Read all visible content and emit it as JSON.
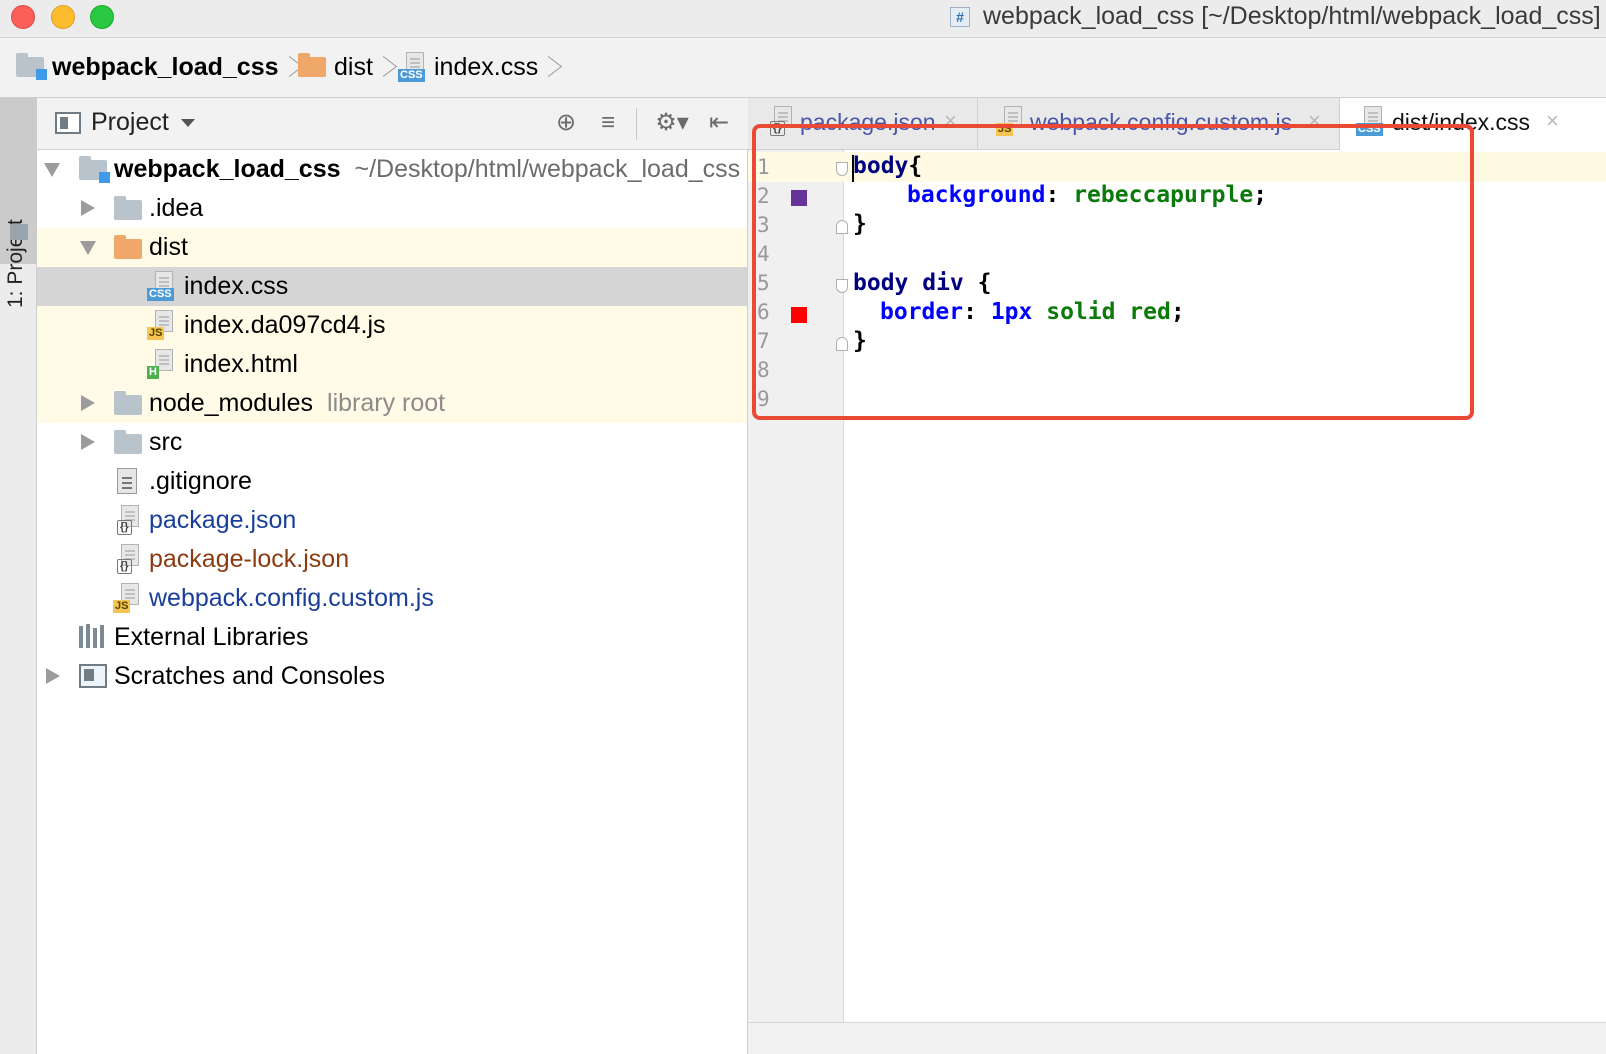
{
  "window": {
    "title": "webpack_load_css [~/Desktop/html/webpack_load_css]"
  },
  "breadcrumb": {
    "items": [
      {
        "label": "webpack_load_css",
        "icon": "module-folder-icon"
      },
      {
        "label": "dist",
        "icon": "folder-icon"
      },
      {
        "label": "index.css",
        "icon": "css-file-icon"
      }
    ]
  },
  "toolstrip": {
    "project_tab": "1: Project"
  },
  "project_panel": {
    "title": "Project",
    "tools": [
      "locate-icon",
      "collapse-all-icon",
      "settings-icon",
      "hide-panel-icon"
    ]
  },
  "tree": {
    "root": {
      "label": "webpack_load_css",
      "path": "~/Desktop/html/webpack_load_css"
    },
    "idea": ".idea",
    "dist": "dist",
    "index_css": "index.css",
    "index_js": "index.da097cd4.js",
    "index_html": "index.html",
    "node_modules": "node_modules",
    "node_modules_hint": "library root",
    "src": "src",
    "gitignore": ".gitignore",
    "package_json": "package.json",
    "package_lock": "package-lock.json",
    "webpack_config": "webpack.config.custom.js",
    "external_libs": "External Libraries",
    "scratches": "Scratches and Consoles"
  },
  "editor": {
    "tabs": [
      {
        "label": "package.json",
        "active": false
      },
      {
        "label": "webpack.config.custom.js",
        "active": false
      },
      {
        "label": "dist/index.css",
        "active": true
      }
    ],
    "line_numbers": [
      "1",
      "2",
      "3",
      "4",
      "5",
      "6",
      "7",
      "8",
      "9"
    ],
    "code": {
      "l1_sel": "body",
      "l1_brace": "{",
      "l2_prop": "background",
      "l2_colon": ":",
      "l2_val": "rebeccapurple",
      "l2_semi": ";",
      "l3": "}",
      "l5_sel": "body div",
      "l5_brace": " {",
      "l6_prop": "border",
      "l6_colon": ":",
      "l6_num": "1px",
      "l6_val": "solid red",
      "l6_semi": ";",
      "l7": "}"
    },
    "swatches": {
      "line2": "#663399",
      "line6": "#ff0000"
    }
  },
  "colors": {
    "annotation": "#ea4a35",
    "selection": "#d5d5d5",
    "highlight_row": "#fffbe6"
  }
}
